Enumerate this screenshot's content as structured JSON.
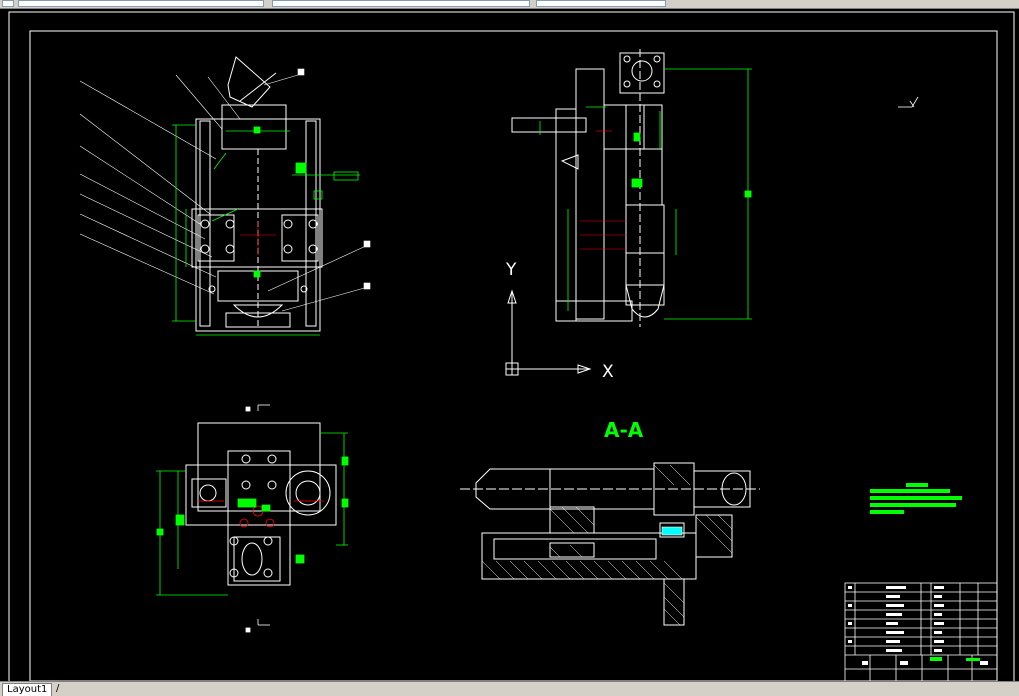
{
  "app": {
    "tab_label": "Layout1"
  },
  "drawing": {
    "ucs_y": "Y",
    "ucs_x": "X",
    "section_label": "A-A"
  },
  "colors": {
    "background": "#000000",
    "geometry": "#ffffff",
    "dimension": "#00ff00",
    "hidden": "#ff0000"
  }
}
